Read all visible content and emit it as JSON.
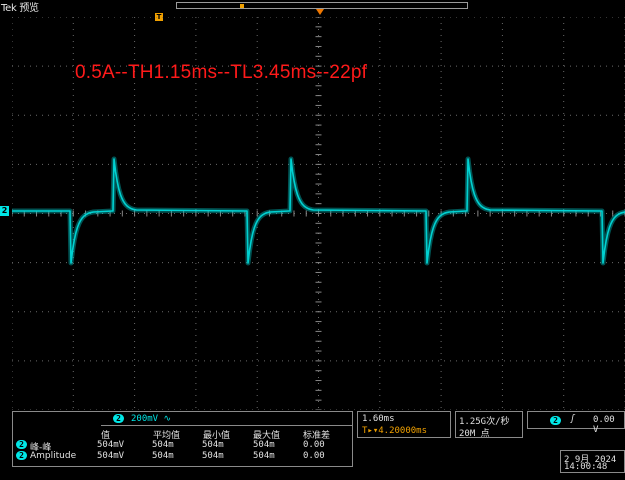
{
  "header": {
    "brand": "Tek 预览"
  },
  "trigger_markers": {
    "position_label": "T"
  },
  "annotation": "0.5A--TH1.15ms--TL3.45ms--22pf",
  "channel": {
    "marker_label": "2",
    "color": "#00e6e6",
    "scale": "200mV ∿"
  },
  "measurements": {
    "columns": [
      "值",
      "平均值",
      "最小值",
      "最大值",
      "标准差"
    ],
    "rows": [
      {
        "channel": "2",
        "name": "峰-峰",
        "value": "504mV",
        "mean": "504m",
        "min": "504m",
        "max": "504m",
        "std": "0.00"
      },
      {
        "channel": "2",
        "name": "Amplitude",
        "value": "504mV",
        "mean": "504m",
        "min": "504m",
        "max": "504m",
        "std": "0.00"
      }
    ]
  },
  "timebase": {
    "scale": "1.60ms",
    "position": "T▸▾4.20000ms"
  },
  "acquisition": {
    "sample_rate": "1.25G次/秒",
    "record_length": "20M 点"
  },
  "trigger": {
    "source": "2",
    "slope": "ʃ",
    "level": "0.00 V"
  },
  "datetime": {
    "date": "2 9月 2024",
    "time": "14:00:48"
  },
  "colors": {
    "trace": "#00e6e6",
    "annotation": "#ff1a1a",
    "trigger": "#f0a000",
    "grid": "#6a6a6a"
  }
}
